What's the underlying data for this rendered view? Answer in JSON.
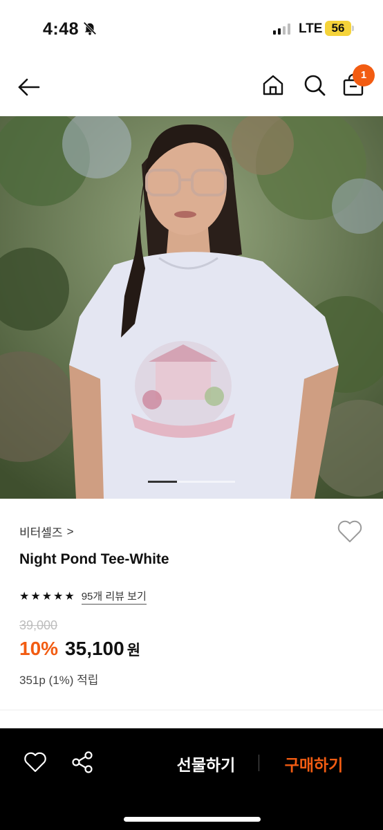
{
  "status_bar": {
    "time": "4:48",
    "network": "LTE",
    "battery": "56",
    "icons": [
      "bell-off-icon",
      "signal-icon"
    ]
  },
  "nav": {
    "back_icon": "arrow-left-icon",
    "home_icon": "home-icon",
    "search_icon": "search-icon",
    "bag_icon": "shopping-bag-icon",
    "cart_count": "1"
  },
  "product": {
    "brand": "비터셀즈",
    "brand_chevron": ">",
    "name": "Night Pond Tee-White",
    "rating_stars": 5,
    "star_glyph": "★",
    "review_link": "95개 리뷰 보기",
    "original_price": "39,000",
    "discount": "10%",
    "price": "35,100",
    "currency": "원",
    "points": "351p (1%) 적립",
    "image_pager": {
      "count": 3,
      "active": 1
    }
  },
  "actions": {
    "gift_label": "선물하기",
    "buy_label": "구매하기"
  },
  "colors": {
    "accent": "#f25c12",
    "bottom_bar": "#000000",
    "battery": "#f5d33a"
  }
}
